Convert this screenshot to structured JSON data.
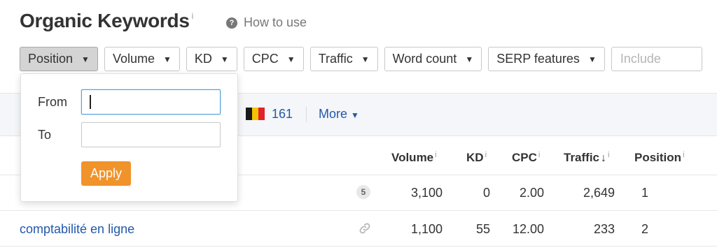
{
  "header": {
    "title": "Organic Keywords",
    "title_info": "i",
    "howto_label": "How to use",
    "howto_icon": "?"
  },
  "filters": {
    "items": [
      {
        "label": "Position"
      },
      {
        "label": "Volume"
      },
      {
        "label": "KD"
      },
      {
        "label": "CPC"
      },
      {
        "label": "Traffic"
      },
      {
        "label": "Word count"
      },
      {
        "label": "SERP features"
      }
    ],
    "include_placeholder": "Include"
  },
  "position_dropdown": {
    "from_label": "From",
    "to_label": "To",
    "from_value": "",
    "to_value": "",
    "apply_label": "Apply"
  },
  "country_bar": {
    "flag": "belgium-flag",
    "count": "161",
    "more_label": "More"
  },
  "table": {
    "headers": {
      "volume": "Volume",
      "kd": "KD",
      "cpc": "CPC",
      "traffic": "Traffic",
      "position": "Position",
      "info": "i"
    },
    "rows": [
      {
        "keyword": "",
        "serp_count": "5",
        "volume": "3,100",
        "kd": "0",
        "cpc": "2.00",
        "traffic": "2,649",
        "position": "1"
      },
      {
        "keyword": "comptabilité en ligne",
        "serp_count": "",
        "volume": "1,100",
        "kd": "55",
        "cpc": "12.00",
        "traffic": "233",
        "position": "2"
      }
    ]
  },
  "colors": {
    "link": "#2458a8",
    "apply": "#f0932b",
    "flag_black": "#1a1a1a",
    "flag_yellow": "#f5c400",
    "flag_red": "#e0212f"
  }
}
